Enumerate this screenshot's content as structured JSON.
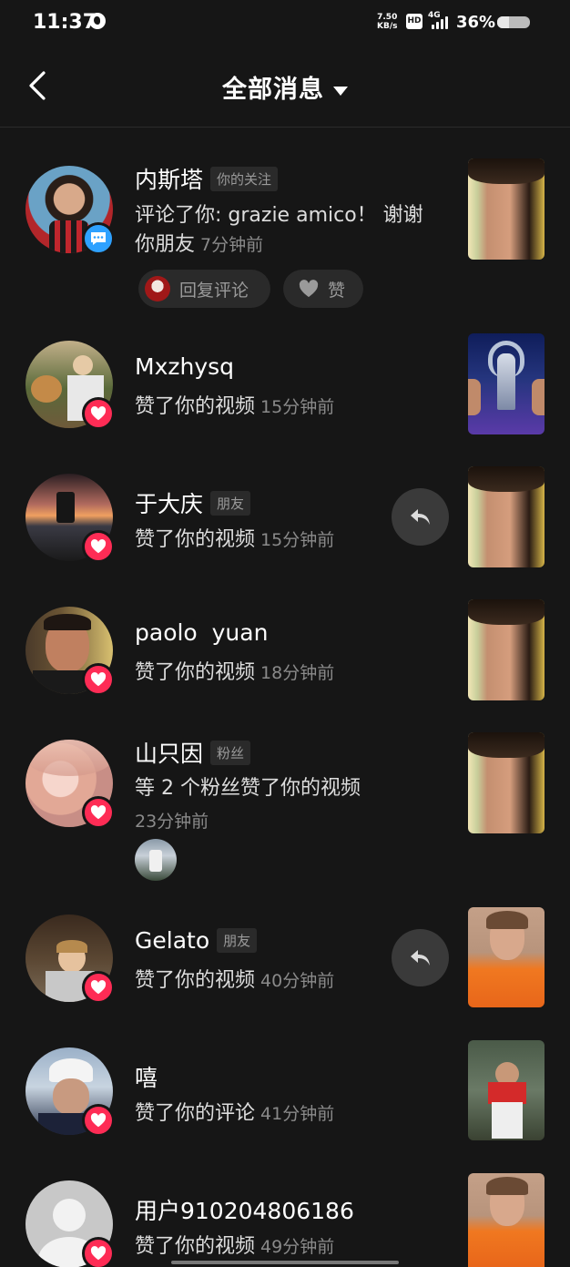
{
  "status_bar": {
    "time": "11:37",
    "net_speed_value": "7.50",
    "net_speed_unit": "KB/s",
    "hd_label": "HD",
    "network_label": "4G",
    "battery_text": "36%",
    "battery_level": 0.36
  },
  "header": {
    "title": "全部消息"
  },
  "items": [
    {
      "name": "内斯塔",
      "tag": "你的关注",
      "desc_line1": "评论了你: grazie amico！ 谢谢",
      "desc_line2": "你朋友",
      "time": "7分钟前",
      "reply_chip_label": "回复评论",
      "like_chip_label": "赞"
    },
    {
      "name": "Mxzhysq",
      "desc": "赞了你的视频",
      "time": "15分钟前"
    },
    {
      "name": "于大庆",
      "tag": "朋友",
      "desc": "赞了你的视频",
      "time": "15分钟前"
    },
    {
      "name": "paolo  yuan",
      "desc": "赞了你的视频",
      "time": "18分钟前"
    },
    {
      "name": "山只因",
      "tag": "粉丝",
      "desc": "等 2 个粉丝赞了你的视频",
      "time": "23分钟前"
    },
    {
      "name": "Gelato",
      "tag": "朋友",
      "desc": "赞了你的视频",
      "time": "40分钟前"
    },
    {
      "name": "嘻",
      "desc": "赞了你的评论",
      "time": "41分钟前"
    },
    {
      "name": "用户910204806186",
      "desc": "赞了你的视频",
      "time": "49分钟前"
    }
  ],
  "colors": {
    "background": "#161616",
    "like_badge": "#fe2c55",
    "comment_badge": "#2ea1ff",
    "secondary_text": "#8a8a8a"
  }
}
